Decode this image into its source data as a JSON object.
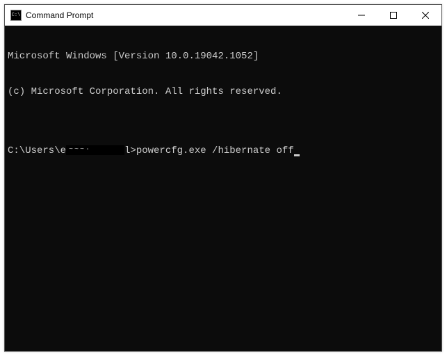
{
  "titlebar": {
    "icon_label": "C:\\",
    "title": "Command Prompt"
  },
  "terminal": {
    "line1": "Microsoft Windows [Version 10.0.19042.1052]",
    "line2": "(c) Microsoft Corporation. All rights reserved.",
    "blank": "",
    "prompt_prefix": "C:\\Users\\e",
    "prompt_suffix": "l>",
    "command": "powercfg.exe /hibernate off"
  }
}
